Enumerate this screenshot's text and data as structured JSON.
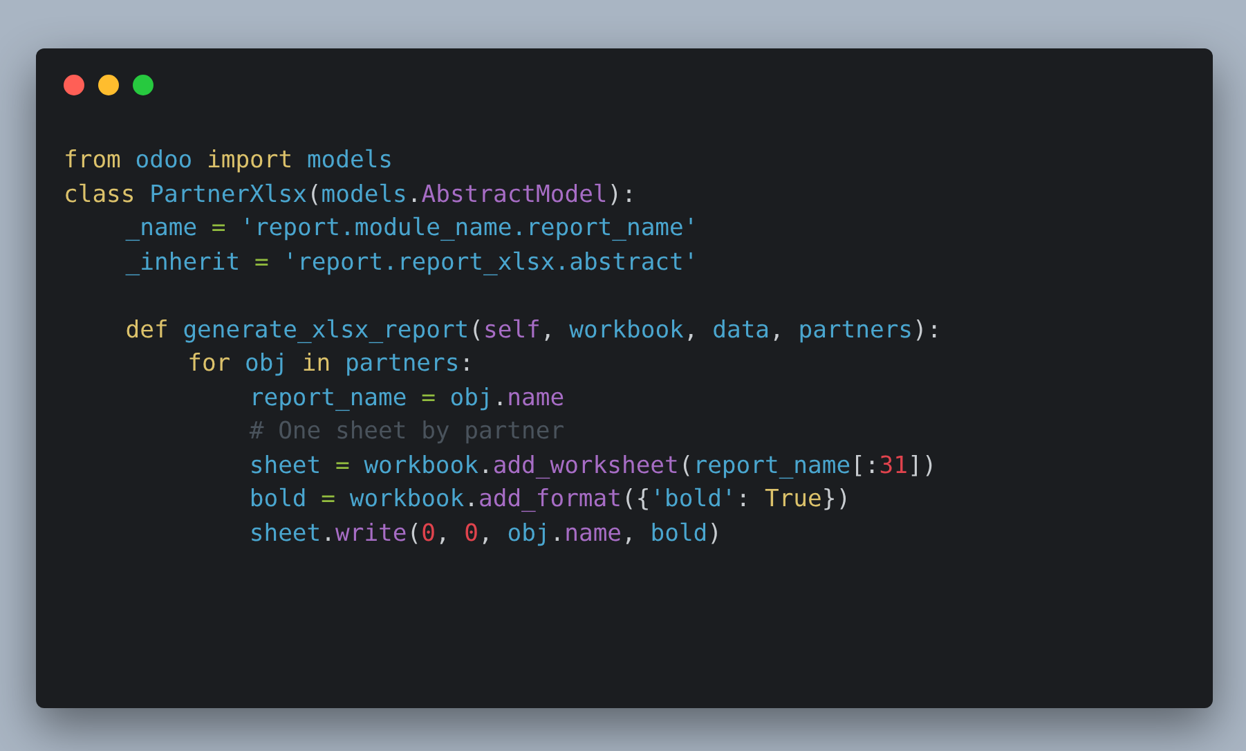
{
  "window": {
    "controls": [
      {
        "color": "#ff5f56"
      },
      {
        "color": "#ffbd2e"
      },
      {
        "color": "#27c93f"
      }
    ]
  },
  "code": [
    {
      "tokens": [
        {
          "kind": "keyword",
          "text": "from"
        },
        {
          "kind": "name",
          "text": " odoo"
        },
        {
          "kind": "keyword",
          "text": " import"
        },
        {
          "kind": "name",
          "text": " models"
        }
      ]
    },
    {
      "tokens": [
        {
          "kind": "keyword",
          "text": "class"
        },
        {
          "kind": "name",
          "text": " PartnerXlsx"
        },
        {
          "kind": "punct",
          "text": "("
        },
        {
          "kind": "name",
          "text": "models"
        },
        {
          "kind": "punct",
          "text": "."
        },
        {
          "kind": "attr",
          "text": "AbstractModel"
        },
        {
          "kind": "punct",
          "text": "):"
        }
      ],
      "children": [
        {
          "tokens": [
            {
              "kind": "name",
              "text": "_name"
            },
            {
              "kind": "op",
              "text": " = "
            },
            {
              "kind": "string",
              "text": "'report.module_name.report_name'"
            }
          ]
        },
        {
          "tokens": [
            {
              "kind": "name",
              "text": "_inherit"
            },
            {
              "kind": "op",
              "text": " = "
            },
            {
              "kind": "string",
              "text": "'report.report_xlsx.abstract'"
            }
          ]
        },
        {
          "kind": "blank"
        },
        {
          "tokens": [
            {
              "kind": "keyword",
              "text": "def"
            },
            {
              "kind": "name",
              "text": " generate_xlsx_report"
            },
            {
              "kind": "punct",
              "text": "("
            },
            {
              "kind": "attr",
              "text": "self"
            },
            {
              "kind": "punct",
              "text": ", "
            },
            {
              "kind": "name",
              "text": "workbook"
            },
            {
              "kind": "punct",
              "text": ", "
            },
            {
              "kind": "name",
              "text": "data"
            },
            {
              "kind": "punct",
              "text": ", "
            },
            {
              "kind": "name",
              "text": "partners"
            },
            {
              "kind": "punct",
              "text": "):"
            }
          ],
          "children": [
            {
              "tokens": [
                {
                  "kind": "keyword",
                  "text": "for"
                },
                {
                  "kind": "name",
                  "text": " obj"
                },
                {
                  "kind": "keyword",
                  "text": " in"
                },
                {
                  "kind": "name",
                  "text": " partners"
                },
                {
                  "kind": "punct",
                  "text": ":"
                }
              ],
              "children": [
                {
                  "tokens": [
                    {
                      "kind": "name",
                      "text": "report_name"
                    },
                    {
                      "kind": "op",
                      "text": " = "
                    },
                    {
                      "kind": "name",
                      "text": "obj"
                    },
                    {
                      "kind": "punct",
                      "text": "."
                    },
                    {
                      "kind": "attr",
                      "text": "name"
                    }
                  ]
                },
                {
                  "tokens": [
                    {
                      "kind": "comment",
                      "text": "# One sheet by partner"
                    }
                  ]
                },
                {
                  "tokens": [
                    {
                      "kind": "name",
                      "text": "sheet"
                    },
                    {
                      "kind": "op",
                      "text": " = "
                    },
                    {
                      "kind": "name",
                      "text": "workbook"
                    },
                    {
                      "kind": "punct",
                      "text": "."
                    },
                    {
                      "kind": "attr",
                      "text": "add_worksheet"
                    },
                    {
                      "kind": "punct",
                      "text": "("
                    },
                    {
                      "kind": "name",
                      "text": "report_name"
                    },
                    {
                      "kind": "punct",
                      "text": "[:"
                    },
                    {
                      "kind": "number",
                      "text": "31"
                    },
                    {
                      "kind": "punct",
                      "text": "])"
                    }
                  ]
                },
                {
                  "tokens": [
                    {
                      "kind": "name",
                      "text": "bold"
                    },
                    {
                      "kind": "op",
                      "text": " = "
                    },
                    {
                      "kind": "name",
                      "text": "workbook"
                    },
                    {
                      "kind": "punct",
                      "text": "."
                    },
                    {
                      "kind": "attr",
                      "text": "add_format"
                    },
                    {
                      "kind": "punct",
                      "text": "({"
                    },
                    {
                      "kind": "string",
                      "text": "'bold'"
                    },
                    {
                      "kind": "punct",
                      "text": ": "
                    },
                    {
                      "kind": "constant",
                      "text": "True"
                    },
                    {
                      "kind": "punct",
                      "text": "})"
                    }
                  ]
                },
                {
                  "tokens": [
                    {
                      "kind": "name",
                      "text": "sheet"
                    },
                    {
                      "kind": "punct",
                      "text": "."
                    },
                    {
                      "kind": "attr",
                      "text": "write"
                    },
                    {
                      "kind": "punct",
                      "text": "("
                    },
                    {
                      "kind": "number",
                      "text": "0"
                    },
                    {
                      "kind": "punct",
                      "text": ", "
                    },
                    {
                      "kind": "number",
                      "text": "0"
                    },
                    {
                      "kind": "punct",
                      "text": ", "
                    },
                    {
                      "kind": "name",
                      "text": "obj"
                    },
                    {
                      "kind": "punct",
                      "text": "."
                    },
                    {
                      "kind": "attr",
                      "text": "name"
                    },
                    {
                      "kind": "punct",
                      "text": ", "
                    },
                    {
                      "kind": "name",
                      "text": "bold"
                    },
                    {
                      "kind": "punct",
                      "text": ")"
                    }
                  ]
                }
              ]
            }
          ]
        }
      ]
    }
  ]
}
